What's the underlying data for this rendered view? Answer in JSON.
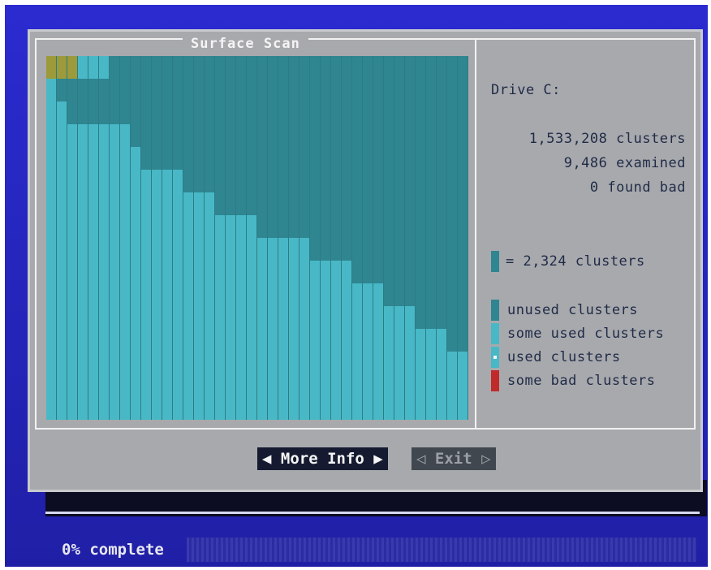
{
  "dialog": {
    "title": "Surface Scan",
    "more_info_label": "◀ More Info ▶",
    "exit_label": "◁ Exit ▷"
  },
  "info": {
    "drive_label": "Drive C:",
    "total_clusters": "1,533,208 clusters",
    "examined": "9,486 examined",
    "found_bad": "0 found bad",
    "scale_text": "= 2,324 clusters"
  },
  "legend": {
    "unused": "unused clusters",
    "some_used": "some used clusters",
    "used": "used clusters",
    "some_bad": "some bad clusters"
  },
  "progress": {
    "label": "0% complete",
    "percent": 0
  },
  "colors": {
    "unused": "#2f8590",
    "some_used": "#48b8c6",
    "used": "#48b8c6",
    "bad": "#c02a2a",
    "examined": "#9c9a3a",
    "dialog_bg": "#a8a9ad",
    "screen_bg": "#2424b8"
  },
  "cluster_map": {
    "columns": 40,
    "rows": 16,
    "cells": [
      "XXXSSSUUUUUUUUUUUUUUUUUUUUUUUUUUUUUUUUUU",
      "SUUUUUUUUUUUUUUUUUUUUUUUUUUUUUUUUUUUUUUU",
      "SSUUUUUUUUUUUUUUUUUUUUUUUUUUUUUUUUUUUUUU",
      "SSSSSSSSUUUUUUUUUUUUUUUUUUUUUUUUUUUUUUUU",
      "SSSSSSSSSUUUUUUUUUUUUUUUUUUUUUUUUUUUUUUU",
      "SSSSSSSSSSSSSUUUUUUUUUUUUUUUUUUUUUUUUUUU",
      "SSSSSSSSSSSSSSSSUUUUUUUUUUUUUUUUUUUUUUUU",
      "SSSSSSSSSSSSSSSSSSSSUUUUUUUUUUUUUUUUUUUU",
      "SSSSSSSSSSSSSSSSSSSSSSSSSUUUUUUUUUUUUUUU",
      "SSSSSSSSSSSSSSSSSSSSSSSSSSSSSUUUUUUUUUUU",
      "SSSSSSSSSSSSSSSSSSSSSSSSSSSSSSSSUUUUUUUU",
      "SSSSSSSSSSSSSSSSSSSSSSSSSSSSSSSSSSSUUUUU",
      "SSSSSSSSSSSSSSSSSSSSSSSSSSSSSSSSSSSSSSUU",
      "SSSSSSSSSSSSSSSSSSSSSSSSSSSSSSSSSSSSSSSS",
      "SSSSSSSSSSSSSSSSSSSSSSSSSSSSSSSSSSSSSSSS",
      "SSSSSSSSSSSSSSSSSSSSSSSSSSSSSSSSSSSSSSSS"
    ]
  }
}
